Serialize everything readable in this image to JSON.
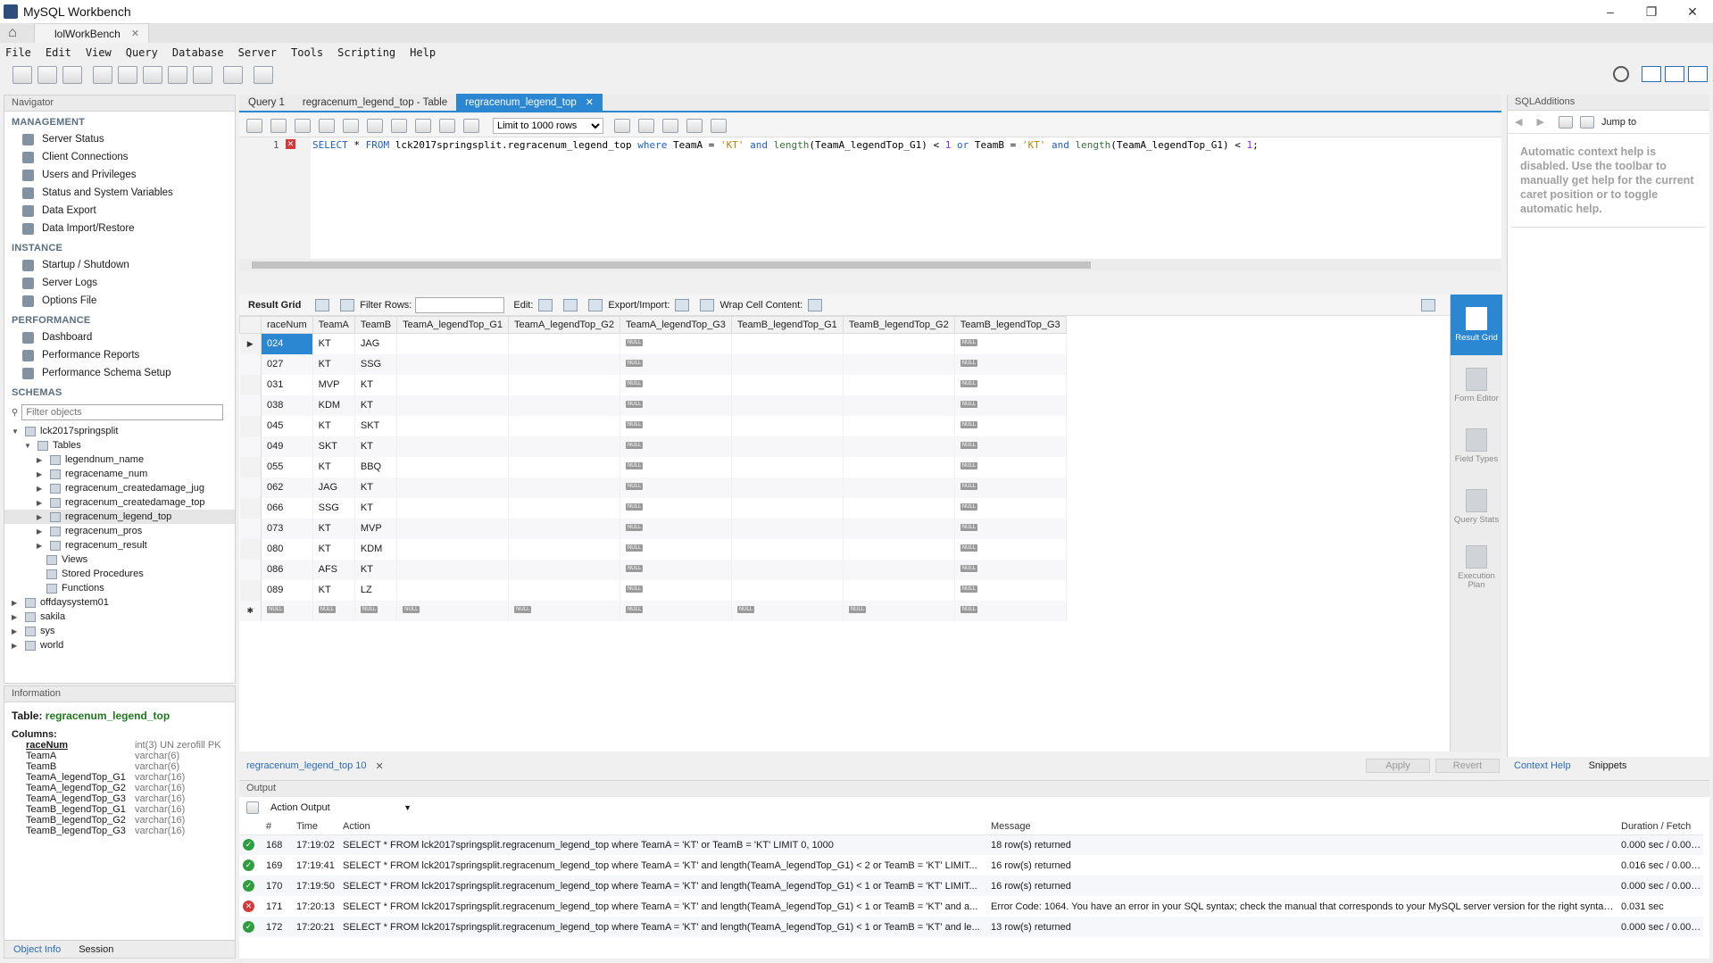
{
  "window": {
    "title": "MySQL Workbench",
    "minimize": "–",
    "maximize": "❐",
    "close": "✕"
  },
  "connection_tab": {
    "label": "lolWorkBench",
    "close": "✕"
  },
  "menu": [
    "File",
    "Edit",
    "View",
    "Query",
    "Database",
    "Server",
    "Tools",
    "Scripting",
    "Help"
  ],
  "navigator": {
    "header": "Navigator",
    "management": {
      "title": "MANAGEMENT",
      "items": [
        "Server Status",
        "Client Connections",
        "Users and Privileges",
        "Status and System Variables",
        "Data Export",
        "Data Import/Restore"
      ]
    },
    "instance": {
      "title": "INSTANCE",
      "items": [
        "Startup / Shutdown",
        "Server Logs",
        "Options File"
      ]
    },
    "performance": {
      "title": "PERFORMANCE",
      "items": [
        "Dashboard",
        "Performance Reports",
        "Performance Schema Setup"
      ]
    },
    "schemas": {
      "title": "SCHEMAS",
      "filter_placeholder": "Filter objects",
      "db": "lck2017springsplit",
      "tables_label": "Tables",
      "tables": [
        "legendnum_name",
        "regracename_num",
        "regracenum_createdamage_jug",
        "regracenum_createdamage_top",
        "regracenum_legend_top",
        "regracenum_pros",
        "regracenum_result"
      ],
      "views": "Views",
      "stored_procedures": "Stored Procedures",
      "functions": "Functions",
      "other_dbs": [
        "offdaysystem01",
        "sakila",
        "sys",
        "world"
      ]
    }
  },
  "information": {
    "header": "Information",
    "table_prefix": "Table:",
    "table_name": "regracenum_legend_top",
    "columns_label": "Columns:",
    "columns": [
      {
        "name": "raceNum",
        "type": "int(3) UN zerofill PK"
      },
      {
        "name": "TeamA",
        "type": "varchar(6)"
      },
      {
        "name": "TeamB",
        "type": "varchar(6)"
      },
      {
        "name": "TeamA_legendTop_G1",
        "type": "varchar(16)"
      },
      {
        "name": "TeamA_legendTop_G2",
        "type": "varchar(16)"
      },
      {
        "name": "TeamA_legendTop_G3",
        "type": "varchar(16)"
      },
      {
        "name": "TeamB_legendTop_G1",
        "type": "varchar(16)"
      },
      {
        "name": "TeamB_legendTop_G2",
        "type": "varchar(16)"
      },
      {
        "name": "TeamB_legendTop_G3",
        "type": "varchar(16)"
      }
    ],
    "tab_object_info": "Object Info",
    "tab_session": "Session"
  },
  "editor_tabs": [
    {
      "label": "Query 1",
      "active": false
    },
    {
      "label": "regracenum_legend_top - Table",
      "active": false
    },
    {
      "label": "regracenum_legend_top",
      "active": true
    }
  ],
  "editor_toolbar": {
    "limit_label": "Limit to 1000 rows"
  },
  "editor": {
    "line_number": "1",
    "sql_parts": [
      {
        "t": "SELECT",
        "c": "kw"
      },
      {
        "t": " * ",
        "c": ""
      },
      {
        "t": "FROM",
        "c": "kw"
      },
      {
        "t": " lck2017springsplit.regracenum_legend_top ",
        "c": ""
      },
      {
        "t": "where",
        "c": "kw"
      },
      {
        "t": " TeamA = ",
        "c": ""
      },
      {
        "t": "'KT'",
        "c": "str"
      },
      {
        "t": " ",
        "c": ""
      },
      {
        "t": "and",
        "c": "kw"
      },
      {
        "t": " ",
        "c": ""
      },
      {
        "t": "length",
        "c": "fn"
      },
      {
        "t": "(TeamA_legendTop_G1) < ",
        "c": ""
      },
      {
        "t": "1",
        "c": "num"
      },
      {
        "t": " ",
        "c": ""
      },
      {
        "t": "or",
        "c": "kw"
      },
      {
        "t": " TeamB = ",
        "c": ""
      },
      {
        "t": "'KT'",
        "c": "str"
      },
      {
        "t": " ",
        "c": ""
      },
      {
        "t": "and",
        "c": "kw"
      },
      {
        "t": " ",
        "c": ""
      },
      {
        "t": "length",
        "c": "fn"
      },
      {
        "t": "(TeamA_legendTop_G1) < ",
        "c": ""
      },
      {
        "t": "1",
        "c": "num"
      },
      {
        "t": ";",
        "c": ""
      }
    ]
  },
  "result_toolbar": {
    "result_grid": "Result Grid",
    "filter_rows": "Filter Rows:",
    "edit": "Edit:",
    "export_import": "Export/Import:",
    "wrap": "Wrap Cell Content:"
  },
  "result": {
    "columns": [
      "raceNum",
      "TeamA",
      "TeamB",
      "TeamA_legendTop_G1",
      "TeamA_legendTop_G2",
      "TeamA_legendTop_G3",
      "TeamB_legendTop_G1",
      "TeamB_legendTop_G2",
      "TeamB_legendTop_G3"
    ],
    "null_label": "NULL",
    "rows": [
      [
        "024",
        "KT",
        "JAG",
        "",
        "",
        "NULL",
        "",
        "",
        "NULL"
      ],
      [
        "027",
        "KT",
        "SSG",
        "",
        "",
        "NULL",
        "",
        "",
        "NULL"
      ],
      [
        "031",
        "MVP",
        "KT",
        "",
        "",
        "NULL",
        "",
        "",
        "NULL"
      ],
      [
        "038",
        "KDM",
        "KT",
        "",
        "",
        "NULL",
        "",
        "",
        "NULL"
      ],
      [
        "045",
        "KT",
        "SKT",
        "",
        "",
        "NULL",
        "",
        "",
        "NULL"
      ],
      [
        "049",
        "SKT",
        "KT",
        "",
        "",
        "NULL",
        "",
        "",
        "NULL"
      ],
      [
        "055",
        "KT",
        "BBQ",
        "",
        "",
        "NULL",
        "",
        "",
        "NULL"
      ],
      [
        "062",
        "JAG",
        "KT",
        "",
        "",
        "NULL",
        "",
        "",
        "NULL"
      ],
      [
        "066",
        "SSG",
        "KT",
        "",
        "",
        "NULL",
        "",
        "",
        "NULL"
      ],
      [
        "073",
        "KT",
        "MVP",
        "",
        "",
        "NULL",
        "",
        "",
        "NULL"
      ],
      [
        "080",
        "KT",
        "KDM",
        "",
        "",
        "NULL",
        "",
        "",
        "NULL"
      ],
      [
        "086",
        "AFS",
        "KT",
        "",
        "",
        "NULL",
        "",
        "",
        "NULL"
      ],
      [
        "089",
        "KT",
        "LZ",
        "",
        "",
        "NULL",
        "",
        "",
        "NULL"
      ],
      [
        "NULL",
        "NULL",
        "NULL",
        "NULL",
        "NULL",
        "NULL",
        "NULL",
        "NULL",
        "NULL"
      ]
    ]
  },
  "result_side": [
    {
      "label": "Result Grid",
      "active": true
    },
    {
      "label": "Form Editor",
      "active": false
    },
    {
      "label": "Field Types",
      "active": false
    },
    {
      "label": "Query Stats",
      "active": false
    },
    {
      "label": "Execution Plan",
      "active": false
    }
  ],
  "result_footer": {
    "tab": "regracenum_legend_top 10",
    "apply": "Apply",
    "revert": "Revert"
  },
  "sql_additions": {
    "header": "SQLAdditions",
    "jump_to": "Jump to",
    "help_text": "Automatic context help is disabled. Use the toolbar to manually get help for the current caret position or to toggle automatic help.",
    "tab_context_help": "Context Help",
    "tab_snippets": "Snippets"
  },
  "output": {
    "header": "Output",
    "selector": "Action Output",
    "columns": [
      "#",
      "Time",
      "Action",
      "Message",
      "Duration / Fetch"
    ],
    "rows": [
      {
        "status": "ok",
        "num": "168",
        "time": "17:19:02",
        "action": "SELECT * FROM lck2017springsplit.regracenum_legend_top where TeamA = 'KT' or TeamB = 'KT' LIMIT 0, 1000",
        "message": "18 row(s) returned",
        "duration": "0.000 sec / 0.000 sec"
      },
      {
        "status": "ok",
        "num": "169",
        "time": "17:19:41",
        "action": "SELECT * FROM lck2017springsplit.regracenum_legend_top where TeamA = 'KT' and length(TeamA_legendTop_G1) < 2 or TeamB = 'KT' LIMIT...",
        "message": "16 row(s) returned",
        "duration": "0.016 sec / 0.000 sec"
      },
      {
        "status": "ok",
        "num": "170",
        "time": "17:19:50",
        "action": "SELECT * FROM lck2017springsplit.regracenum_legend_top where TeamA = 'KT' and length(TeamA_legendTop_G1) < 1 or TeamB = 'KT' LIMIT...",
        "message": "16 row(s) returned",
        "duration": "0.000 sec / 0.000 sec"
      },
      {
        "status": "err",
        "num": "171",
        "time": "17:20:13",
        "action": "SELECT * FROM lck2017springsplit.regracenum_legend_top where TeamA = 'KT' and length(TeamA_legendTop_G1) < 1 or TeamB = 'KT' and a...",
        "message": "Error Code: 1064. You have an error in your SQL syntax; check the manual that corresponds to your MySQL server version for the right syntax to ...",
        "duration": "0.031 sec"
      },
      {
        "status": "ok",
        "num": "172",
        "time": "17:20:21",
        "action": "SELECT * FROM lck2017springsplit.regracenum_legend_top where TeamA = 'KT' and length(TeamA_legendTop_G1) < 1 or TeamB = 'KT' and le...",
        "message": "13 row(s) returned",
        "duration": "0.000 sec / 0.000 sec"
      }
    ]
  }
}
